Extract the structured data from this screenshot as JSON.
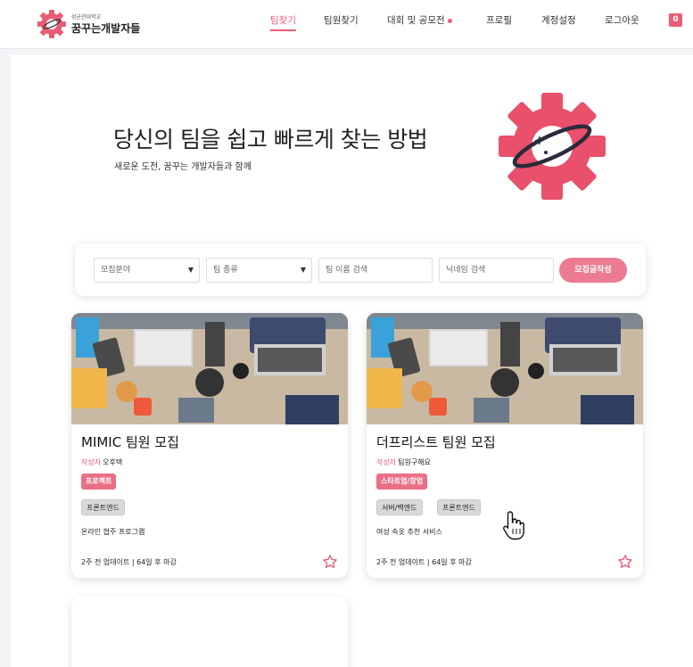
{
  "header": {
    "logo_small": "성균관대학교",
    "logo_main": "꿈꾸는개발자들",
    "nav": [
      "팀찾기",
      "팀원찾기",
      "대회 및 공모전",
      "프로필",
      "계정설정",
      "로그아웃"
    ],
    "active_nav": "팀찾기",
    "notification_count": "0",
    "accent_color": "#e85c75"
  },
  "hero": {
    "title": "당신의 팀을 쉽고 빠르게 찾는 방법",
    "subtitle": "새로운 도전, 꿈꾸는 개발자들과 함께"
  },
  "filter": {
    "field_placeholder": "모집분야",
    "team_type_placeholder": "팀 종류",
    "team_name_placeholder": "팀 이름 검색",
    "nickname_placeholder": "닉네임 검색",
    "write_button": "모집글작성"
  },
  "cards": [
    {
      "title": "MIMIC 팀원 모집",
      "author_label": "작성자",
      "author": "오후택",
      "category": "프로젝트",
      "positions": [
        "프론트엔드"
      ],
      "description": "온라인 협주 프로그램",
      "footer": "2주 전 업데이트 | 64일 후 마감"
    },
    {
      "title": "더프리스트 팀원 모집",
      "author_label": "작성자",
      "author": "팀원구해요",
      "category": "스타트업/창업",
      "positions": [
        "서버/백엔드",
        "프론트엔드"
      ],
      "description": "여성 속옷 추천 서비스",
      "footer": "2주 전 업데이트 | 64일 후 마감"
    }
  ]
}
